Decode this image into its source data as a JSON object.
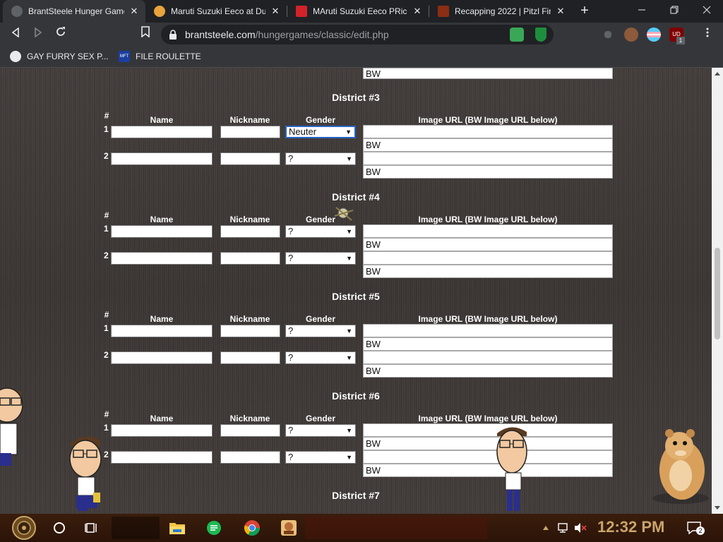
{
  "browser": {
    "tabs": [
      {
        "title": "BrantSteele Hunger Games",
        "active": true
      },
      {
        "title": "Maruti Suzuki Eeco at Du",
        "active": false
      },
      {
        "title": "MAruti Suzuki Eeco PRice",
        "active": false
      },
      {
        "title": "Recapping 2022 | Pitzl Fir",
        "active": false
      }
    ],
    "tab_close": "✕",
    "new_tab": "+",
    "url_host": "brantsteele.com",
    "url_path": "/hungergames/classic/edit.php",
    "extension_badge": "1",
    "ext_ud_label": "UD",
    "bookmarks": [
      {
        "label": "GAY FURRY SEX P..."
      },
      {
        "label": "FILE ROULETTE"
      }
    ],
    "mft_label": "MFT"
  },
  "form": {
    "columns": {
      "num": "#",
      "name": "Name",
      "nickname": "Nickname",
      "gender": "Gender",
      "image": "Image URL (BW Image URL below)"
    },
    "bw_value": "BW",
    "top_partial_bw": "BW",
    "districts": [
      {
        "title": "District #3",
        "tributes": [
          {
            "num": "1",
            "name": "",
            "nickname": "",
            "gender": "Neuter",
            "image_url": "",
            "bw_url": "BW"
          },
          {
            "num": "2",
            "name": "",
            "nickname": "",
            "gender": "?",
            "image_url": "",
            "bw_url": "BW"
          }
        ]
      },
      {
        "title": "District #4",
        "tributes": [
          {
            "num": "1",
            "name": "",
            "nickname": "",
            "gender": "?",
            "image_url": "",
            "bw_url": "BW"
          },
          {
            "num": "2",
            "name": "",
            "nickname": "",
            "gender": "?",
            "image_url": "",
            "bw_url": "BW"
          }
        ]
      },
      {
        "title": "District #5",
        "tributes": [
          {
            "num": "1",
            "name": "",
            "nickname": "",
            "gender": "?",
            "image_url": "",
            "bw_url": "BW"
          },
          {
            "num": "2",
            "name": "",
            "nickname": "",
            "gender": "?",
            "image_url": "",
            "bw_url": "BW"
          }
        ]
      },
      {
        "title": "District #6",
        "tributes": [
          {
            "num": "1",
            "name": "",
            "nickname": "",
            "gender": "?",
            "image_url": "",
            "bw_url": "BW"
          },
          {
            "num": "2",
            "name": "",
            "nickname": "",
            "gender": "?",
            "image_url": "",
            "bw_url": "BW"
          }
        ]
      },
      {
        "title": "District #7",
        "tributes": []
      }
    ]
  },
  "taskbar": {
    "clock": "12:32 PM",
    "notification_count": "2"
  },
  "colors": {
    "page_bg": "#3f3a38",
    "chrome_dark": "#202124",
    "chrome_toolbar": "#35363a",
    "focus_border": "#2563c9",
    "clock": "#c9a56a"
  }
}
